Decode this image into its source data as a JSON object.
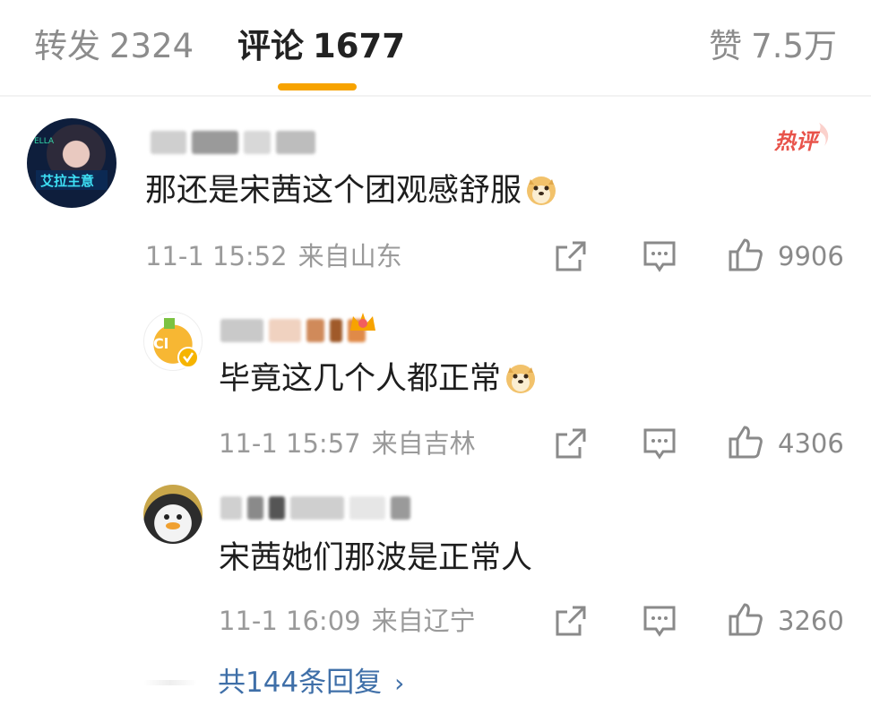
{
  "tabs": {
    "repost_label": "转发",
    "repost_count": "2324",
    "comment_label": "评论",
    "comment_count": "1677",
    "like_label": "赞",
    "like_count": "7.5万"
  },
  "colors": {
    "accent": "#f7a300",
    "link": "#3f6fa8",
    "meta": "#9a9a9a",
    "hot": "#e8534a"
  },
  "hot_badge": "热评",
  "comments": [
    {
      "text": "那还是宋茜这个团观感舒服",
      "emoji": "doge-emoji",
      "date": "11-1 15:52",
      "location": "来自山东",
      "likes": "9906"
    },
    {
      "text": "毕竟这几个人都正常",
      "emoji": "doge-emoji",
      "date": "11-1 15:57",
      "location": "来自吉林",
      "likes": "4306"
    },
    {
      "text": "宋茜她们那波是正常人",
      "date": "11-1 16:09",
      "location": "来自辽宁",
      "likes": "3260"
    }
  ],
  "more_replies": "共144条回复",
  "icons": [
    "share-icon",
    "comment-icon",
    "thumbs-up-icon",
    "chevron-right-icon"
  ]
}
